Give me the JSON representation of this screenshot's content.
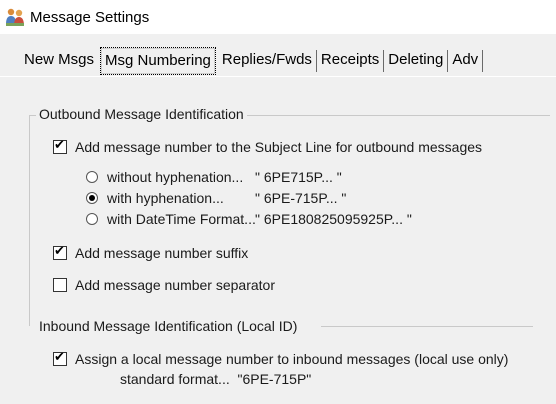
{
  "window": {
    "title": "Message Settings",
    "icon": "people-icon"
  },
  "tabs": [
    {
      "label": "New Msgs",
      "active": false
    },
    {
      "label": "Msg Numbering",
      "active": true
    },
    {
      "label": "Replies/Fwds",
      "active": false
    },
    {
      "label": "Receipts",
      "active": false
    },
    {
      "label": "Deleting",
      "active": false
    },
    {
      "label": "Adv",
      "active": false
    }
  ],
  "outbound": {
    "group_label": "Outbound Message Identification",
    "add_to_subject": {
      "label": "Add message number to the Subject Line for outbound messages",
      "checked": true
    },
    "formats": [
      {
        "label": "without hyphenation...",
        "example": "\" 6PE715P... \"",
        "selected": false
      },
      {
        "label": "with hyphenation...",
        "example": "\" 6PE-715P... \"",
        "selected": true
      },
      {
        "label": "with DateTime Format...",
        "example": "\" 6PE180825095925P... \"",
        "selected": false
      }
    ],
    "suffix": {
      "label": "Add message number suffix",
      "checked": true
    },
    "separator": {
      "label": "Add message number separator",
      "checked": false
    }
  },
  "inbound": {
    "group_label": "Inbound Message Identification (Local ID)",
    "assign_local": {
      "label": "Assign a local message number to inbound messages (local use only)",
      "checked": true
    },
    "standard_format": "standard format...  \"6PE-715P\""
  }
}
